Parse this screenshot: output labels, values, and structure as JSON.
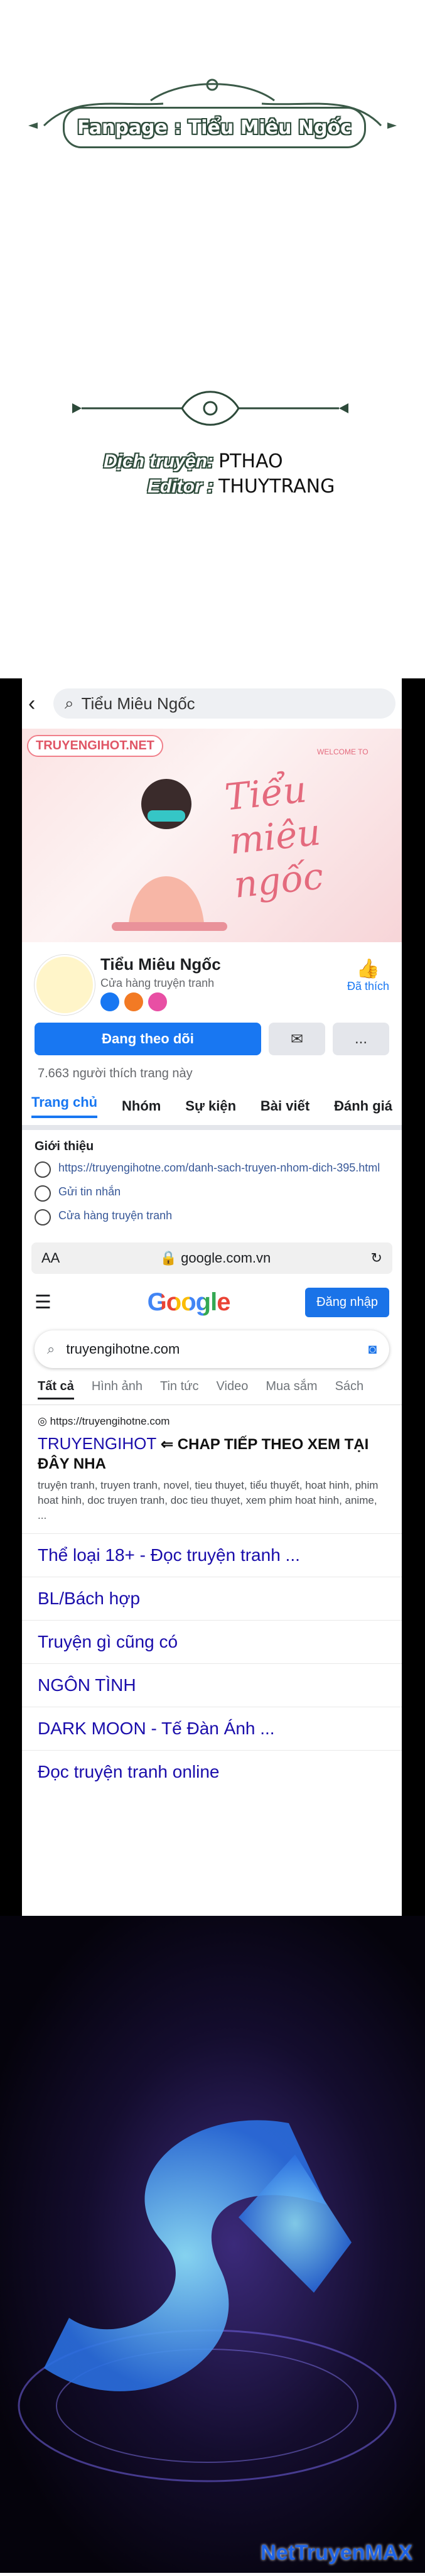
{
  "banner": {
    "text": "Fanpage : Tiểu Miêu Ngốc"
  },
  "credits": {
    "translator_key": "Dịch truyện:",
    "translator_val": "PTHAO",
    "editor_key": "Editor :",
    "editor_val": "THUYTRANG"
  },
  "fb": {
    "search": "Tiểu Miêu Ngốc",
    "cover_tag": "TRUYENGIHOT.NET",
    "cover_welcome": "WELCOME TO",
    "cover_script": "Tiểu miêu ngốc",
    "page_name": "Tiểu Miêu Ngốc",
    "page_category": "Cửa hàng truyện tranh",
    "liked_label": "Đã thích",
    "follow_label": "Đang theo dõi",
    "more_label": "...",
    "likes_count": "7.663 người thích trang này",
    "tabs": [
      "Trang chủ",
      "Nhóm",
      "Sự kiện",
      "Bài viết",
      "Đánh giá"
    ],
    "intro_title": "Giới thiệu",
    "intro_link": "https://truyengihotne.com/danh-sach-truyen-nhom-dich-395.html",
    "intro_msg": "Gửi tin nhắn",
    "intro_store": "Cửa hàng truyện tranh"
  },
  "browser": {
    "aa": "AA",
    "url": "google.com.vn"
  },
  "google": {
    "logo": "Google",
    "signin": "Đăng nhập",
    "query": "truyengihotne.com",
    "tabs": [
      "Tất cả",
      "Hình ảnh",
      "Tin tức",
      "Video",
      "Mua sắm",
      "Sách"
    ],
    "result_url": "https://truyengihotne.com",
    "result_title": "TRUYENGIHOT",
    "result_note": "⇐ CHAP TIẾP THEO XEM TẠI ĐÂY NHA",
    "result_desc": "truyện tranh, truyen tranh, novel, tieu thuyet, tiểu thuyết, hoat hinh, phim hoat hinh, doc truyen tranh, doc tieu thuyet, xem phim hoat hinh, anime, ...",
    "links": [
      "Thể loại 18+ - Đọc truyện tranh ...",
      "BL/Bách hợp",
      "Truyện gì cũng có",
      "NGÔN TÌNH",
      "DARK MOON - Tế Đàn Ánh ...",
      "Đọc truyện tranh online"
    ]
  },
  "footer": {
    "brand": "NetTruyenMAX"
  }
}
